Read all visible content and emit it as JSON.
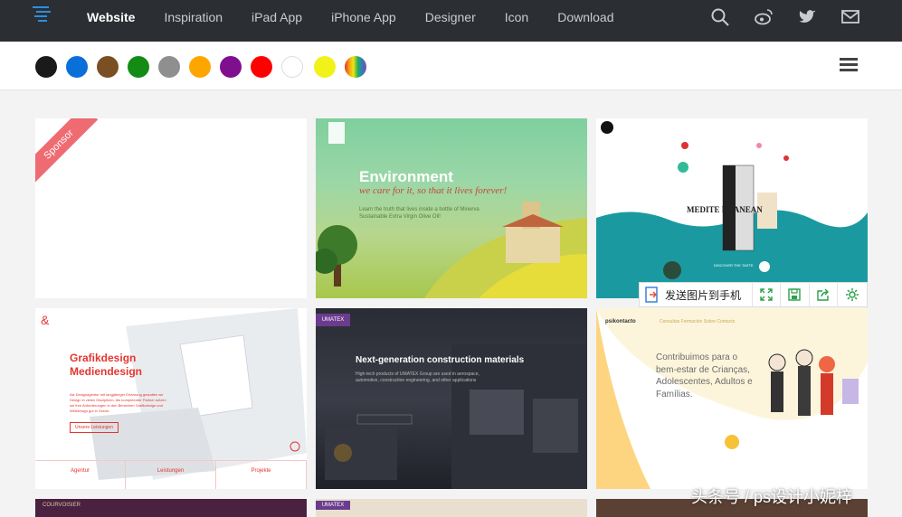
{
  "nav": {
    "items": [
      {
        "label": "Website"
      },
      {
        "label": "Inspiration"
      },
      {
        "label": "iPad App"
      },
      {
        "label": "iPhone App"
      },
      {
        "label": "Designer"
      },
      {
        "label": "Icon"
      },
      {
        "label": "Download"
      }
    ],
    "icons": [
      "search-icon",
      "weibo-icon",
      "twitter-icon",
      "mail-icon"
    ]
  },
  "colors": {
    "filters": [
      "#1a1a1a",
      "#0a6fd9",
      "#7a4f24",
      "#148b14",
      "#8f8f8f",
      "#ffa500",
      "#7f0f8f",
      "#ff0000",
      "#ffffff",
      "#f2f21b",
      "rainbow"
    ],
    "nav_bg": "#2b2f33",
    "accent_ribbon": "#ef6b72"
  },
  "cards": {
    "c1": {
      "ribbon": "Sponsor"
    },
    "c2": {
      "title": "Environment",
      "tagline": "we care for it, so that it lives forever!",
      "body": "Learn the truth that lives inside a bottle of Minerva Sustainable Extra Virgin Olive Oil!"
    },
    "c3": {
      "product": "MEDITE RRANEAN",
      "cta": "DISCOVER THE TASTE"
    },
    "c4": {
      "title1": "Grafikdesign",
      "title2": "Mediendesign",
      "body": "Als Designagentur mit langjähriger Erfahrung gestalten wir Design in vielen Disziplinen. Als kompetenter Partner setzen wir Ihre Anforderungen in den Bereichen Grafikdesign und Webdesign gut in Szene.",
      "link": "Unsere Leistungen",
      "footer": [
        "Agentur",
        "Leistungen",
        "Projekte"
      ]
    },
    "c5": {
      "badge": "UMATEX",
      "title": "Next-generation construction materials",
      "body": "High-tech products of UMATEX Group are used in aerospace, automotive, construction engineering, and other applications"
    },
    "c6": {
      "brand": "psikontacto",
      "menu": "Consultas   Formación   Sobre   Contacto",
      "body": "Contribuimos para o bem-estar de Crianças, Adolescentes, Adultos e Famílias."
    },
    "c7": {
      "brand": "COURVOISIER"
    },
    "c8": {
      "badge": "UMATEX"
    }
  },
  "toolbar": {
    "send_label": "发送图片到手机",
    "icons": [
      "expand-icon",
      "save-icon",
      "share-icon",
      "settings-icon"
    ]
  },
  "watermark": "头条号 / ps设计小妮梓"
}
